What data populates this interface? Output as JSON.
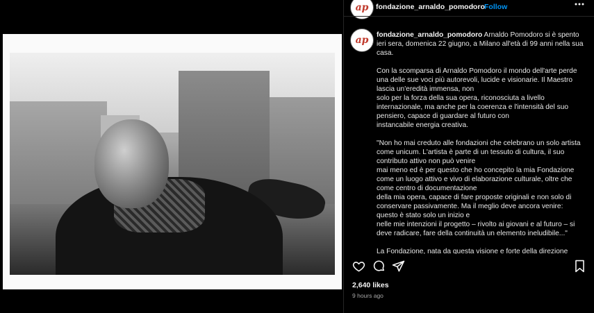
{
  "post": {
    "username": "fondazione_arnaldo_pomodoro",
    "dot": "•",
    "follow_label": "Follow",
    "more_icon": "more-horizontal-icon",
    "caption_paragraphs": [
      "Arnaldo Pomodoro si è spento ieri sera, domenica 22 giugno, a Milano all'età di 99 anni nella sua casa.",
      "Con la scomparsa di Arnaldo Pomodoro il mondo dell'arte perde una delle sue voci più autorevoli, lucide e visionarie. Il Maestro lascia un'eredità immensa, non\nsolo per la forza della sua opera, riconosciuta a livello internazionale, ma anche per la coerenza e l'intensità del suo pensiero, capace di guardare al futuro con\ninstancabile energia creativa.",
      "\"Non ho mai creduto alle fondazioni che celebrano un solo artista come unicum. L'artista è parte di un tessuto di cultura, il suo contributo attivo non può venire\nmai meno ed è per questo che ho concepito la mia Fondazione come un luogo attivo e vivo di elaborazione culturale, oltre che come centro di documentazione\ndella mia opera, capace di fare proposte originali e non solo di conservare passivamente. Ma il meglio deve ancora venire: questo è stato solo un inizio e\nnelle mie intenzioni il progetto – rivolto ai giovani e al futuro – si deve radicare, fare della continuità un elemento ineludibile...\"",
      "La Fondazione, nata da questa visione e forte della direzione"
    ],
    "likes": "2,640 likes",
    "time": "9 hours ago"
  },
  "icons": {
    "like": "heart-icon",
    "comment": "comment-icon",
    "share": "share-icon",
    "save": "bookmark-icon"
  },
  "colors": {
    "accent": "#0095f6",
    "background": "#000000",
    "text": "#f5f5f5",
    "muted": "#a8a8a8"
  }
}
